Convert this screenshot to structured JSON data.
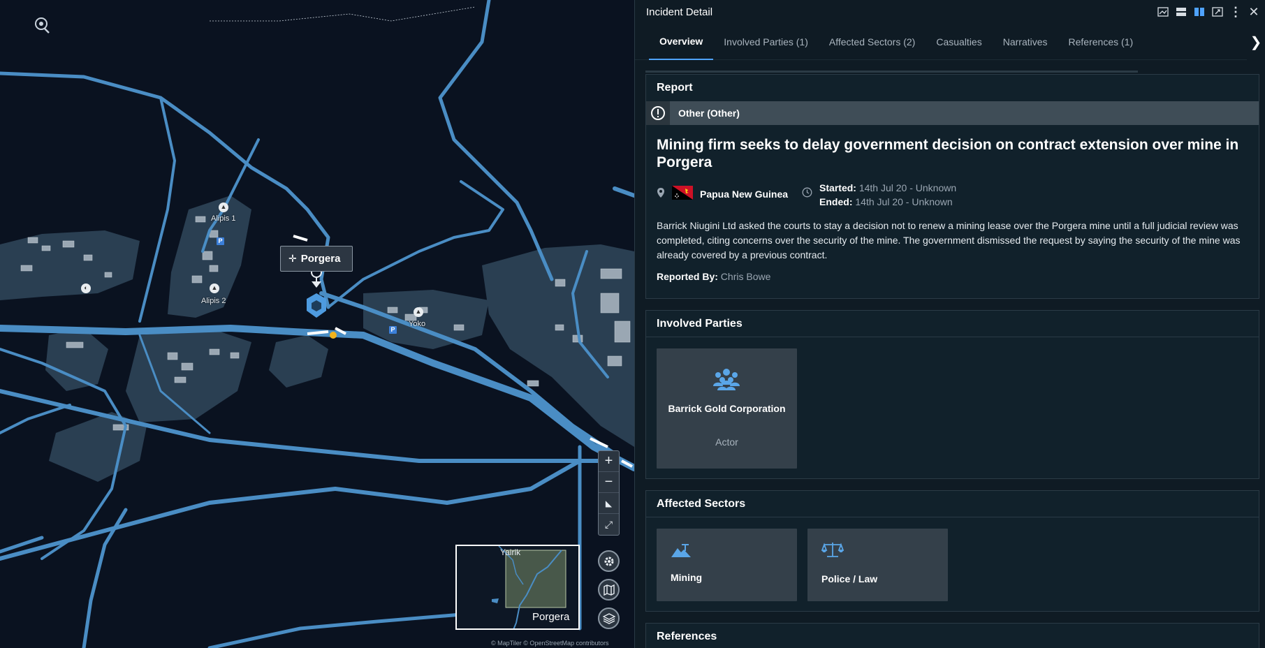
{
  "map": {
    "places": [
      "Alipis 1",
      "Alipis 2",
      "Yoko"
    ],
    "tooltip": "Porgera",
    "minimap": {
      "top_label": "Yairik",
      "bottom_label": "Porgera"
    },
    "attribution": "© MapTiler © OpenStreetMap contributors",
    "zoom_in": "+",
    "zoom_out": "−",
    "poi_parking": "P",
    "colors": {
      "road": "#4a8dc4",
      "water": "#0a1220",
      "area": "#2a3f52"
    }
  },
  "panel": {
    "title": "Incident Detail",
    "tabs": [
      {
        "label": "Overview",
        "active": true
      },
      {
        "label": "Involved Parties (1)"
      },
      {
        "label": "Affected Sectors (2)"
      },
      {
        "label": "Casualties"
      },
      {
        "label": "Narratives"
      },
      {
        "label": "References (1)"
      }
    ],
    "report": {
      "section_title": "Report",
      "category": "Other (Other)",
      "headline": "Mining firm seeks to delay government decision on contract extension over mine in Porgera",
      "country": "Papua New Guinea",
      "started_label": "Started:",
      "started_value": "14th Jul 20 - Unknown",
      "ended_label": "Ended:",
      "ended_value": "14th Jul 20 - Unknown",
      "description": "Barrick Niugini Ltd asked the courts to stay a decision not to renew a mining lease over the Porgera mine until a full judicial review was completed, citing concerns over the security of the mine. The government dismissed the request by saying the security of the mine was already covered by a previous contract.",
      "reported_by_label": "Reported By:",
      "reported_by_value": "Chris Bowe"
    },
    "involved_parties": {
      "section_title": "Involved Parties",
      "parties": [
        {
          "name": "Barrick Gold Corporation",
          "role": "Actor",
          "icon": "group-icon"
        }
      ]
    },
    "affected_sectors": {
      "section_title": "Affected Sectors",
      "sectors": [
        {
          "label": "Mining",
          "icon": "mining-icon"
        },
        {
          "label": "Police / Law",
          "icon": "scales-icon"
        }
      ]
    },
    "references": {
      "section_title": "References"
    },
    "accent_color": "#4fa3ff"
  }
}
